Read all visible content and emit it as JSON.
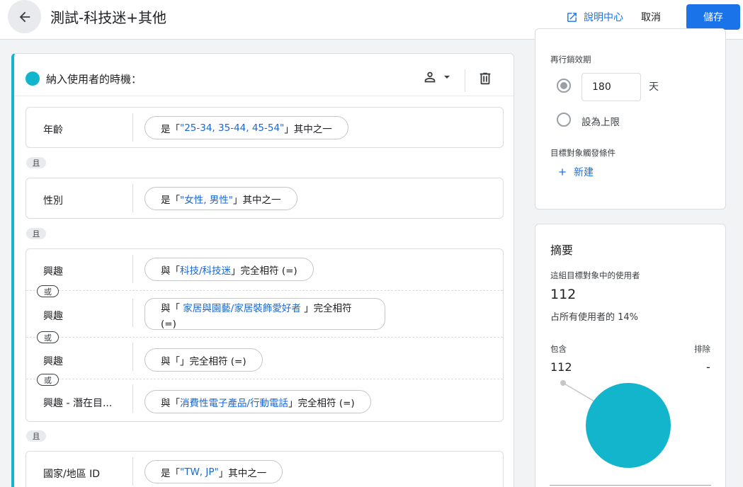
{
  "header": {
    "title": "測試-科技迷+其他",
    "help_label": "說明中心",
    "cancel_label": "取消",
    "save_label": "儲存"
  },
  "condition": {
    "title": "納入使用者的時機：",
    "and_label": "且",
    "or_label": "或",
    "rows": [
      {
        "label": "年齡",
        "prefix": "是「",
        "value": "\"25-34, 35-44, 45-54\"",
        "suffix": "」其中之一"
      },
      {
        "label": "性別",
        "prefix": "是「",
        "value": "\"女性, 男性\"",
        "suffix": "」其中之一"
      },
      {
        "label": "興趣",
        "prefix": "與「",
        "value": "科技/科技迷",
        "suffix": "」完全相符 (=)"
      },
      {
        "label": "興趣",
        "prefix": "與「",
        "value": "家居與園藝/家居裝飾愛好者",
        "suffix": "」完全相符 (=)"
      },
      {
        "label": "興趣",
        "prefix": "與「",
        "value": "",
        "suffix": "」完全相符 (=)"
      },
      {
        "label": "興趣 - 潛在目...",
        "prefix": "與「",
        "value": "消費性電子產品/行動電話",
        "suffix": "」完全相符 (=)"
      },
      {
        "label": "國家/地區 ID",
        "prefix": "是「",
        "value": "\"TW, JP\"",
        "suffix": "」其中之一"
      }
    ]
  },
  "settings": {
    "duration_label": "再行銷效期",
    "duration_value": "180",
    "duration_unit": "天",
    "max_label": "設為上限",
    "trigger_label": "目標對象觸發條件",
    "new_label": "新建"
  },
  "summary": {
    "title": "摘要",
    "users_label": "這組目標對象中的使用者",
    "users_value": "112",
    "users_pct": "占所有使用者的 14%",
    "include_label": "包含",
    "exclude_label": "排除",
    "include_value": "112",
    "exclude_value": "-"
  },
  "colors": {
    "accent": "#1a73e8",
    "teal": "#12b5cb",
    "link": "#1967d2"
  },
  "chart_data": {
    "type": "pie",
    "categories": [
      "包含",
      "排除"
    ],
    "values": [
      112,
      0
    ]
  }
}
